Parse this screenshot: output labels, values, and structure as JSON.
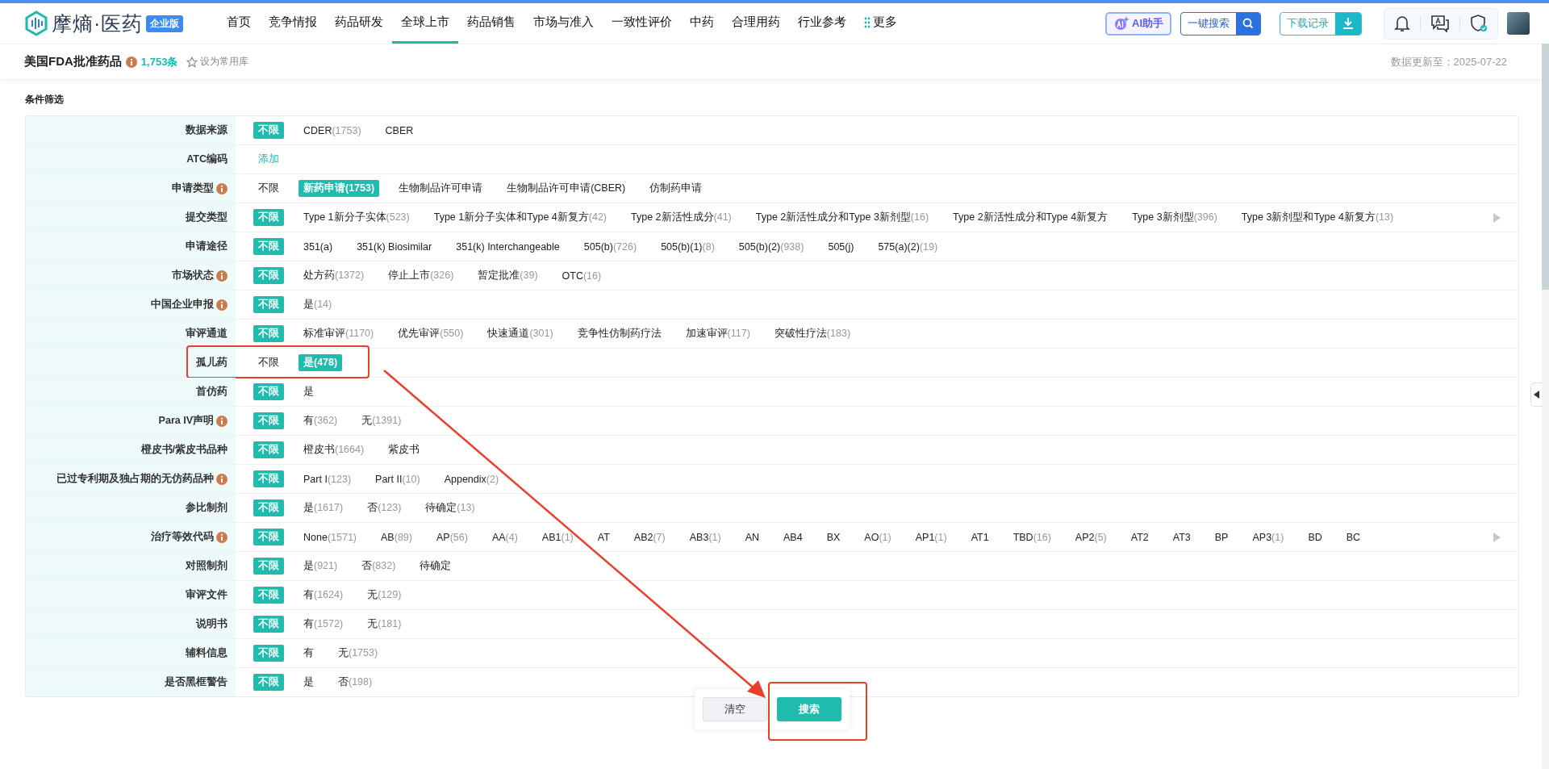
{
  "header": {
    "logo": "摩熵·医药",
    "edition": "企业版",
    "nav": [
      {
        "label": "首页",
        "selected": false
      },
      {
        "label": "竞争情报",
        "selected": false
      },
      {
        "label": "药品研发",
        "selected": false
      },
      {
        "label": "全球上市",
        "selected": true
      },
      {
        "label": "药品销售",
        "selected": false
      },
      {
        "label": "市场与准入",
        "selected": false
      },
      {
        "label": "一致性评价",
        "selected": false
      },
      {
        "label": "中药",
        "selected": false
      },
      {
        "label": "合理用药",
        "selected": false
      },
      {
        "label": "行业参考",
        "selected": false
      }
    ],
    "more": "更多",
    "ai_button": "AI助手",
    "search_button": "一键搜索",
    "download_button": "下载记录"
  },
  "subheader": {
    "title": "美国FDA批准药品",
    "count": "1,753条",
    "favorite": "设为常用库",
    "updated": "数据更新至：2025-07-22"
  },
  "filter": {
    "title": "条件筛选",
    "rows": [
      {
        "label": "数据来源",
        "info": false,
        "more": false,
        "highlighted": false,
        "options": [
          {
            "label": "不限",
            "selected": true
          },
          {
            "label": "CDER",
            "count": "(1753)",
            "selected": false
          },
          {
            "label": "CBER",
            "selected": false
          }
        ]
      },
      {
        "label": "ATC编码",
        "info": false,
        "more": false,
        "highlighted": false,
        "options": [
          {
            "label": "添加",
            "kind": "link"
          }
        ]
      },
      {
        "label": "申请类型",
        "info": true,
        "more": false,
        "highlighted": false,
        "options": [
          {
            "label": "不限",
            "selected": false
          },
          {
            "label": "新药申请",
            "count": "(1753)",
            "selected": true
          },
          {
            "label": "生物制品许可申请",
            "selected": false
          },
          {
            "label": "生物制品许可申请(CBER)",
            "selected": false
          },
          {
            "label": "仿制药申请",
            "selected": false
          }
        ]
      },
      {
        "label": "提交类型",
        "info": false,
        "more": true,
        "highlighted": false,
        "options": [
          {
            "label": "不限",
            "selected": true
          },
          {
            "label": "Type 1新分子实体",
            "count": "(523)",
            "selected": false
          },
          {
            "label": "Type 1新分子实体和Type 4新复方",
            "count": "(42)",
            "selected": false
          },
          {
            "label": "Type 2新活性成分",
            "count": "(41)",
            "selected": false
          },
          {
            "label": "Type 2新活性成分和Type 3新剂型",
            "count": "(16)",
            "selected": false
          },
          {
            "label": "Type 2新活性成分和Type 4新复方",
            "selected": false
          },
          {
            "label": "Type 3新剂型",
            "count": "(396)",
            "selected": false
          },
          {
            "label": "Type 3新剂型和Type 4新复方",
            "count": "(13)",
            "selected": false
          }
        ]
      },
      {
        "label": "申请途径",
        "info": false,
        "more": false,
        "highlighted": false,
        "options": [
          {
            "label": "不限",
            "selected": true
          },
          {
            "label": "351(a)",
            "selected": false
          },
          {
            "label": "351(k) Biosimilar",
            "selected": false
          },
          {
            "label": "351(k) Interchangeable",
            "selected": false
          },
          {
            "label": "505(b)",
            "count": "(726)",
            "selected": false
          },
          {
            "label": "505(b)(1)",
            "count": "(8)",
            "selected": false
          },
          {
            "label": "505(b)(2)",
            "count": "(938)",
            "selected": false
          },
          {
            "label": "505(j)",
            "selected": false
          },
          {
            "label": "575(a)(2)",
            "count": "(19)",
            "selected": false
          }
        ]
      },
      {
        "label": "市场状态",
        "info": true,
        "more": false,
        "highlighted": false,
        "options": [
          {
            "label": "不限",
            "selected": true
          },
          {
            "label": "处方药",
            "count": "(1372)",
            "selected": false
          },
          {
            "label": "停止上市",
            "count": "(326)",
            "selected": false
          },
          {
            "label": "暂定批准",
            "count": "(39)",
            "selected": false
          },
          {
            "label": "OTC",
            "count": "(16)",
            "selected": false
          }
        ]
      },
      {
        "label": "中国企业申报",
        "info": true,
        "more": false,
        "highlighted": false,
        "options": [
          {
            "label": "不限",
            "selected": true
          },
          {
            "label": "是",
            "count": "(14)",
            "selected": false
          }
        ]
      },
      {
        "label": "审评通道",
        "info": false,
        "more": false,
        "highlighted": false,
        "options": [
          {
            "label": "不限",
            "selected": true
          },
          {
            "label": "标准审评",
            "count": "(1170)",
            "selected": false
          },
          {
            "label": "优先审评",
            "count": "(550)",
            "selected": false
          },
          {
            "label": "快速通道",
            "count": "(301)",
            "selected": false
          },
          {
            "label": "竞争性仿制药疗法",
            "selected": false
          },
          {
            "label": "加速审评",
            "count": "(117)",
            "selected": false
          },
          {
            "label": "突破性疗法",
            "count": "(183)",
            "selected": false
          }
        ]
      },
      {
        "label": "孤儿药",
        "info": false,
        "more": false,
        "highlighted": true,
        "options": [
          {
            "label": "不限",
            "selected": false
          },
          {
            "label": "是",
            "count": "(478)",
            "selected": true
          }
        ]
      },
      {
        "label": "首仿药",
        "info": false,
        "more": false,
        "highlighted": false,
        "options": [
          {
            "label": "不限",
            "selected": true
          },
          {
            "label": "是",
            "selected": false
          }
        ]
      },
      {
        "label": "Para IV声明",
        "info": true,
        "more": false,
        "highlighted": false,
        "options": [
          {
            "label": "不限",
            "selected": true
          },
          {
            "label": "有",
            "count": "(362)",
            "selected": false
          },
          {
            "label": "无",
            "count": "(1391)",
            "selected": false
          }
        ]
      },
      {
        "label": "橙皮书/紫皮书品种",
        "info": false,
        "more": false,
        "highlighted": false,
        "options": [
          {
            "label": "不限",
            "selected": true
          },
          {
            "label": "橙皮书",
            "count": "(1664)",
            "selected": false
          },
          {
            "label": "紫皮书",
            "selected": false
          }
        ]
      },
      {
        "label": "已过专利期及独占期的无仿药品种",
        "info": true,
        "more": false,
        "highlighted": false,
        "options": [
          {
            "label": "不限",
            "selected": true
          },
          {
            "label": "Part I",
            "count": "(123)",
            "selected": false
          },
          {
            "label": "Part II",
            "count": "(10)",
            "selected": false
          },
          {
            "label": "Appendix",
            "count": "(2)",
            "selected": false
          }
        ]
      },
      {
        "label": "参比制剂",
        "info": false,
        "more": false,
        "highlighted": false,
        "options": [
          {
            "label": "不限",
            "selected": true
          },
          {
            "label": "是",
            "count": "(1617)",
            "selected": false
          },
          {
            "label": "否",
            "count": "(123)",
            "selected": false
          },
          {
            "label": "待确定",
            "count": "(13)",
            "selected": false
          }
        ]
      },
      {
        "label": "治疗等效代码",
        "info": true,
        "more": true,
        "highlighted": false,
        "options": [
          {
            "label": "不限",
            "selected": true
          },
          {
            "label": "None",
            "count": "(1571)",
            "selected": false
          },
          {
            "label": "AB",
            "count": "(89)",
            "selected": false
          },
          {
            "label": "AP",
            "count": "(56)",
            "selected": false
          },
          {
            "label": "AA",
            "count": "(4)",
            "selected": false
          },
          {
            "label": "AB1",
            "count": "(1)",
            "selected": false
          },
          {
            "label": "AT",
            "selected": false
          },
          {
            "label": "AB2",
            "count": "(7)",
            "selected": false
          },
          {
            "label": "AB3",
            "count": "(1)",
            "selected": false
          },
          {
            "label": "AN",
            "selected": false
          },
          {
            "label": "AB4",
            "selected": false
          },
          {
            "label": "BX",
            "selected": false
          },
          {
            "label": "AO",
            "count": "(1)",
            "selected": false
          },
          {
            "label": "AP1",
            "count": "(1)",
            "selected": false
          },
          {
            "label": "AT1",
            "selected": false
          },
          {
            "label": "TBD",
            "count": "(16)",
            "selected": false
          },
          {
            "label": "AP2",
            "count": "(5)",
            "selected": false
          },
          {
            "label": "AT2",
            "selected": false
          },
          {
            "label": "AT3",
            "selected": false
          },
          {
            "label": "BP",
            "selected": false
          },
          {
            "label": "AP3",
            "count": "(1)",
            "selected": false
          },
          {
            "label": "BD",
            "selected": false
          },
          {
            "label": "BC",
            "selected": false
          }
        ]
      },
      {
        "label": "对照制剂",
        "info": false,
        "more": false,
        "highlighted": false,
        "options": [
          {
            "label": "不限",
            "selected": true
          },
          {
            "label": "是",
            "count": "(921)",
            "selected": false
          },
          {
            "label": "否",
            "count": "(832)",
            "selected": false
          },
          {
            "label": "待确定",
            "selected": false
          }
        ]
      },
      {
        "label": "审评文件",
        "info": false,
        "more": false,
        "highlighted": false,
        "options": [
          {
            "label": "不限",
            "selected": true
          },
          {
            "label": "有",
            "count": "(1624)",
            "selected": false
          },
          {
            "label": "无",
            "count": "(129)",
            "selected": false
          }
        ]
      },
      {
        "label": "说明书",
        "info": false,
        "more": false,
        "highlighted": false,
        "options": [
          {
            "label": "不限",
            "selected": true
          },
          {
            "label": "有",
            "count": "(1572)",
            "selected": false
          },
          {
            "label": "无",
            "count": "(181)",
            "selected": false
          }
        ]
      },
      {
        "label": "辅料信息",
        "info": false,
        "more": false,
        "highlighted": false,
        "options": [
          {
            "label": "不限",
            "selected": true
          },
          {
            "label": "有",
            "selected": false
          },
          {
            "label": "无",
            "count": "(1753)",
            "selected": false
          }
        ]
      },
      {
        "label": "是否黑框警告",
        "info": false,
        "more": false,
        "highlighted": false,
        "options": [
          {
            "label": "不限",
            "selected": true
          },
          {
            "label": "是",
            "selected": false
          },
          {
            "label": "否",
            "count": "(198)",
            "selected": false
          }
        ]
      }
    ]
  },
  "actions": {
    "clear": "清空",
    "search": "搜索",
    "search_highlighted": true
  },
  "arrow": true
}
